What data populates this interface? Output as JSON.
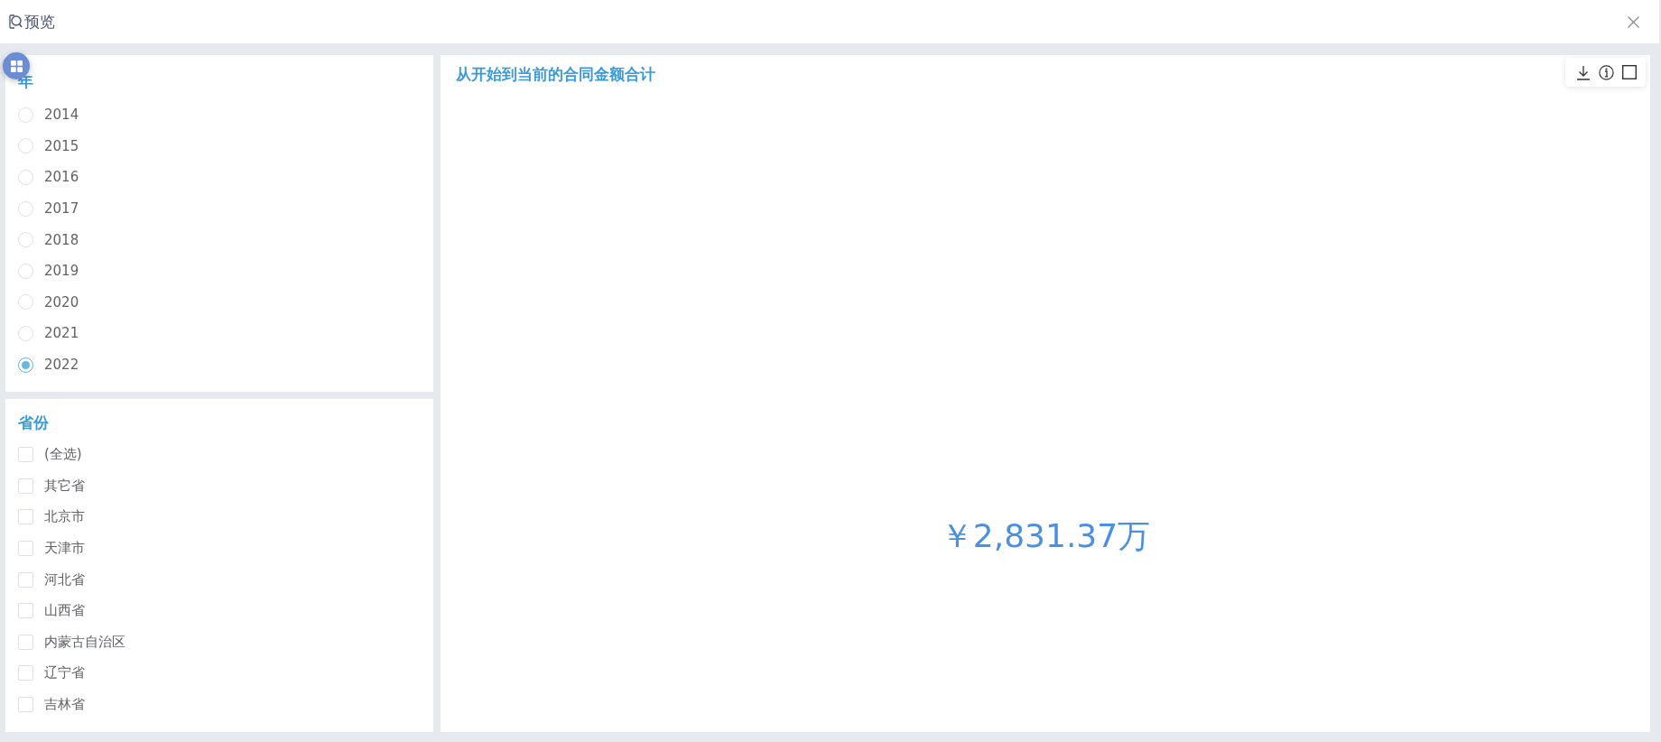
{
  "window": {
    "title": "预览"
  },
  "filters": [
    {
      "kind": "radio",
      "title": "年",
      "options": [
        {
          "label": "2014",
          "selected": false
        },
        {
          "label": "2015",
          "selected": false
        },
        {
          "label": "2016",
          "selected": false
        },
        {
          "label": "2017",
          "selected": false
        },
        {
          "label": "2018",
          "selected": false
        },
        {
          "label": "2019",
          "selected": false
        },
        {
          "label": "2020",
          "selected": false
        },
        {
          "label": "2021",
          "selected": false
        },
        {
          "label": "2022",
          "selected": true
        }
      ]
    },
    {
      "kind": "checkbox",
      "title": "省份",
      "options": [
        {
          "label": "(全选)",
          "checked": false
        },
        {
          "label": "其它省",
          "checked": false
        },
        {
          "label": "北京市",
          "checked": false
        },
        {
          "label": "天津市",
          "checked": false
        },
        {
          "label": "河北省",
          "checked": false
        },
        {
          "label": "山西省",
          "checked": false
        },
        {
          "label": "内蒙古自治区",
          "checked": false
        },
        {
          "label": "辽宁省",
          "checked": false
        },
        {
          "label": "吉林省",
          "checked": false
        }
      ]
    }
  ],
  "card": {
    "title": "从开始到当前的合同金额合计",
    "value": "￥2,831.37万"
  }
}
